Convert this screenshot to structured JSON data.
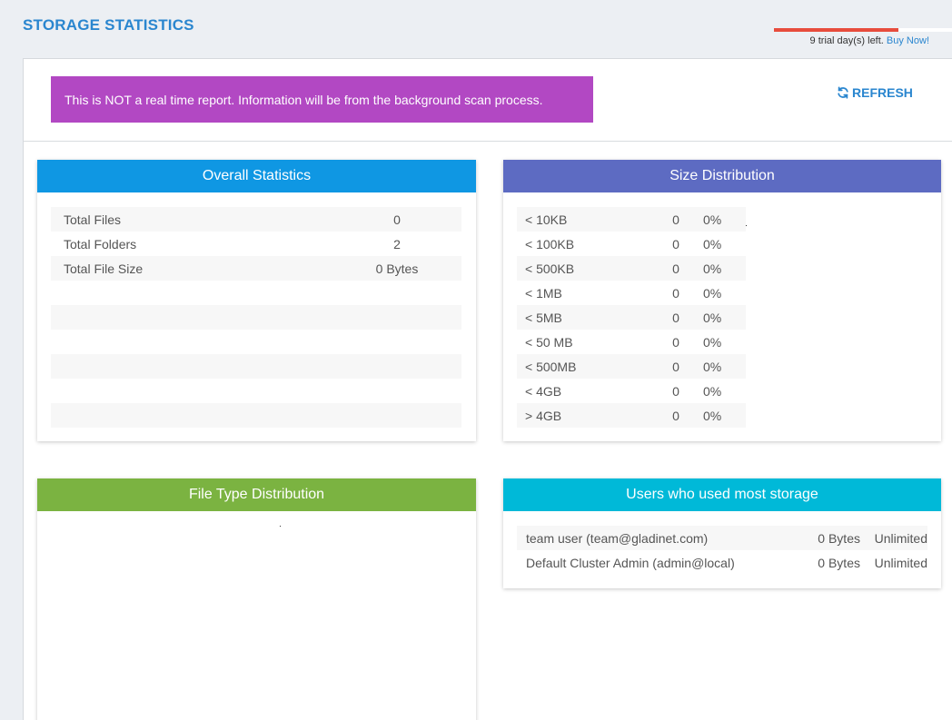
{
  "page": {
    "title": "STORAGE STATISTICS"
  },
  "trial": {
    "text": "9 trial day(s) left.",
    "link": "Buy Now!",
    "remaining_fraction": 0.7,
    "bar_color": "#e74c3c"
  },
  "notice": {
    "text": "This is NOT a real time report. Information will be from the background scan process.",
    "color": "#b248c3"
  },
  "refresh": {
    "label": "REFRESH",
    "icon": "refresh-icon"
  },
  "overall": {
    "title": "Overall Statistics",
    "color": "#0f97e3",
    "rows": [
      {
        "label": "Total Files",
        "value": "0"
      },
      {
        "label": "Total Folders",
        "value": "2"
      },
      {
        "label": "Total File Size",
        "value": "0 Bytes"
      }
    ]
  },
  "size_distribution": {
    "title": "Size Distribution",
    "color": "#5d6bc2",
    "rows": [
      {
        "label": "< 10KB",
        "count": "0",
        "percent": "0%"
      },
      {
        "label": "< 100KB",
        "count": "0",
        "percent": "0%"
      },
      {
        "label": "< 500KB",
        "count": "0",
        "percent": "0%"
      },
      {
        "label": "< 1MB",
        "count": "0",
        "percent": "0%"
      },
      {
        "label": "< 5MB",
        "count": "0",
        "percent": "0%"
      },
      {
        "label": "< 50 MB",
        "count": "0",
        "percent": "0%"
      },
      {
        "label": "< 500MB",
        "count": "0",
        "percent": "0%"
      },
      {
        "label": "< 4GB",
        "count": "0",
        "percent": "0%"
      },
      {
        "label": "> 4GB",
        "count": "0",
        "percent": "0%"
      }
    ]
  },
  "file_type": {
    "title": "File Type Distribution",
    "color": "#7bb341"
  },
  "users": {
    "title": "Users who used most storage",
    "color": "#00b9d8",
    "rows": [
      {
        "name": "team user (team@gladinet.com)",
        "size": "0 Bytes",
        "quota": "Unlimited"
      },
      {
        "name": "Default Cluster Admin (admin@local)",
        "size": "0 Bytes",
        "quota": "Unlimited"
      }
    ]
  }
}
